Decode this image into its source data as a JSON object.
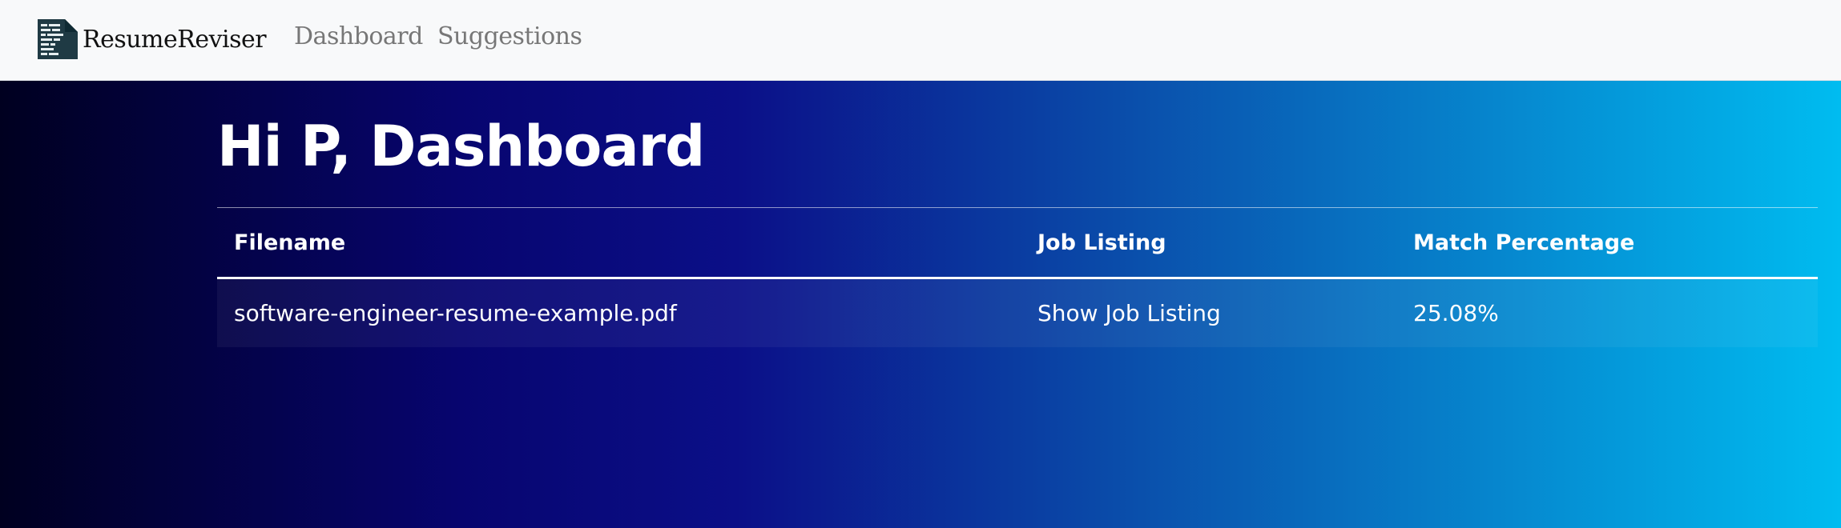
{
  "navbar": {
    "brand": "ResumeReviser",
    "brand_icon": "resume-document-icon",
    "links": [
      "Dashboard",
      "Suggestions"
    ]
  },
  "page": {
    "title": "Hi P, Dashboard"
  },
  "table": {
    "headers": [
      "Filename",
      "Job Listing",
      "Match Percentage"
    ],
    "rows": [
      {
        "filename": "software-engineer-resume-example.pdf",
        "job_listing": "Show Job Listing",
        "match_percentage": "25.08%"
      }
    ]
  },
  "colors": {
    "navbar_bg": "#f8f9fa",
    "gradient_start": "#000020",
    "gradient_mid": "#0b0f88",
    "gradient_end": "#00bcf0",
    "text": "#ffffff"
  }
}
